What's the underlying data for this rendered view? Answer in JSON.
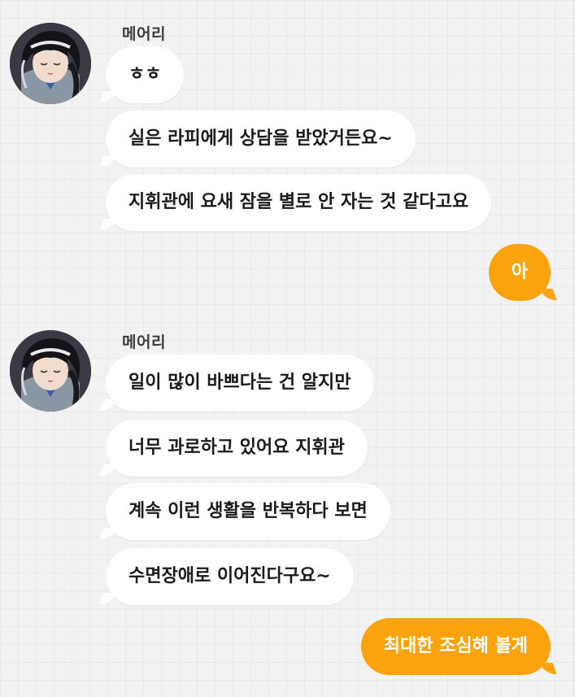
{
  "chat": {
    "groups": [
      {
        "sender": "메어리",
        "avatar_icon": "character-portrait-icon",
        "messages": [
          "ㅎㅎ",
          "실은 라피에게 상담을 받았거든요~",
          "지휘관에 요새 잠을 별로 안 자는 것 같다고요"
        ]
      },
      {
        "reply": "아"
      },
      {
        "sender": "메어리",
        "avatar_icon": "character-portrait-icon",
        "messages": [
          "일이 많이 바쁘다는 건 알지만",
          "너무 과로하고 있어요 지휘관",
          "계속 이런 생활을 반복하다 보면",
          "수면장애로 이어진다구요~"
        ]
      },
      {
        "reply": "최대한 조심해 볼게"
      }
    ]
  },
  "colors": {
    "background": "#f2f2f2",
    "incoming_bubble": "#ffffff",
    "outgoing_bubble": "#fba20f",
    "outgoing_text": "#ffffff"
  }
}
